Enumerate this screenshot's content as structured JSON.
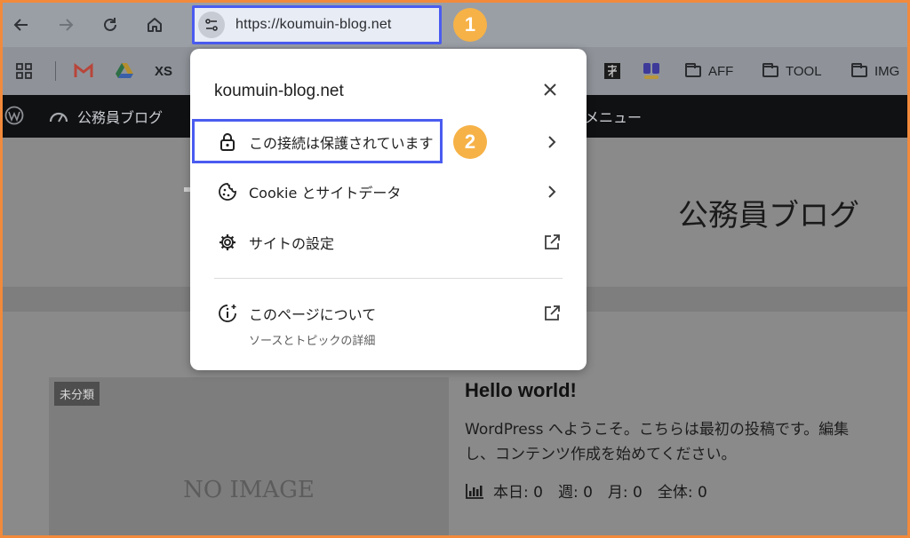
{
  "browser": {
    "url": "https://koumuin-blog.net",
    "step1": "1",
    "step2": "2"
  },
  "bookmarks": {
    "xs_label": "XS",
    "folders": [
      "AFF",
      "TOOL",
      "IMG"
    ]
  },
  "adminbar": {
    "site_name": "公務員ブログ",
    "menu_label": "メニュー"
  },
  "page": {
    "site_title": "公務員ブログ",
    "category_badge": "未分類",
    "no_image": "NO IMAGE",
    "post_title": "Hello world!",
    "excerpt_line1": "WordPress へようこそ。こちらは最初の投稿です。編集",
    "excerpt_line2": "し、コンテンツ作成を始めてください。",
    "stats_text": "本日: 0　週: 0　月: 0　全体: 0"
  },
  "popup": {
    "host": "koumuin-blog.net",
    "items": [
      {
        "label": "この接続は保護されています"
      },
      {
        "label": "Cookie とサイトデータ"
      },
      {
        "label": "サイトの設定"
      },
      {
        "label": "このページについて",
        "sub": "ソースとトピックの詳細"
      }
    ]
  },
  "colors": {
    "highlight": "#4a5cf0",
    "step_badge": "#f6b247",
    "outer_border": "#f28a3c"
  }
}
